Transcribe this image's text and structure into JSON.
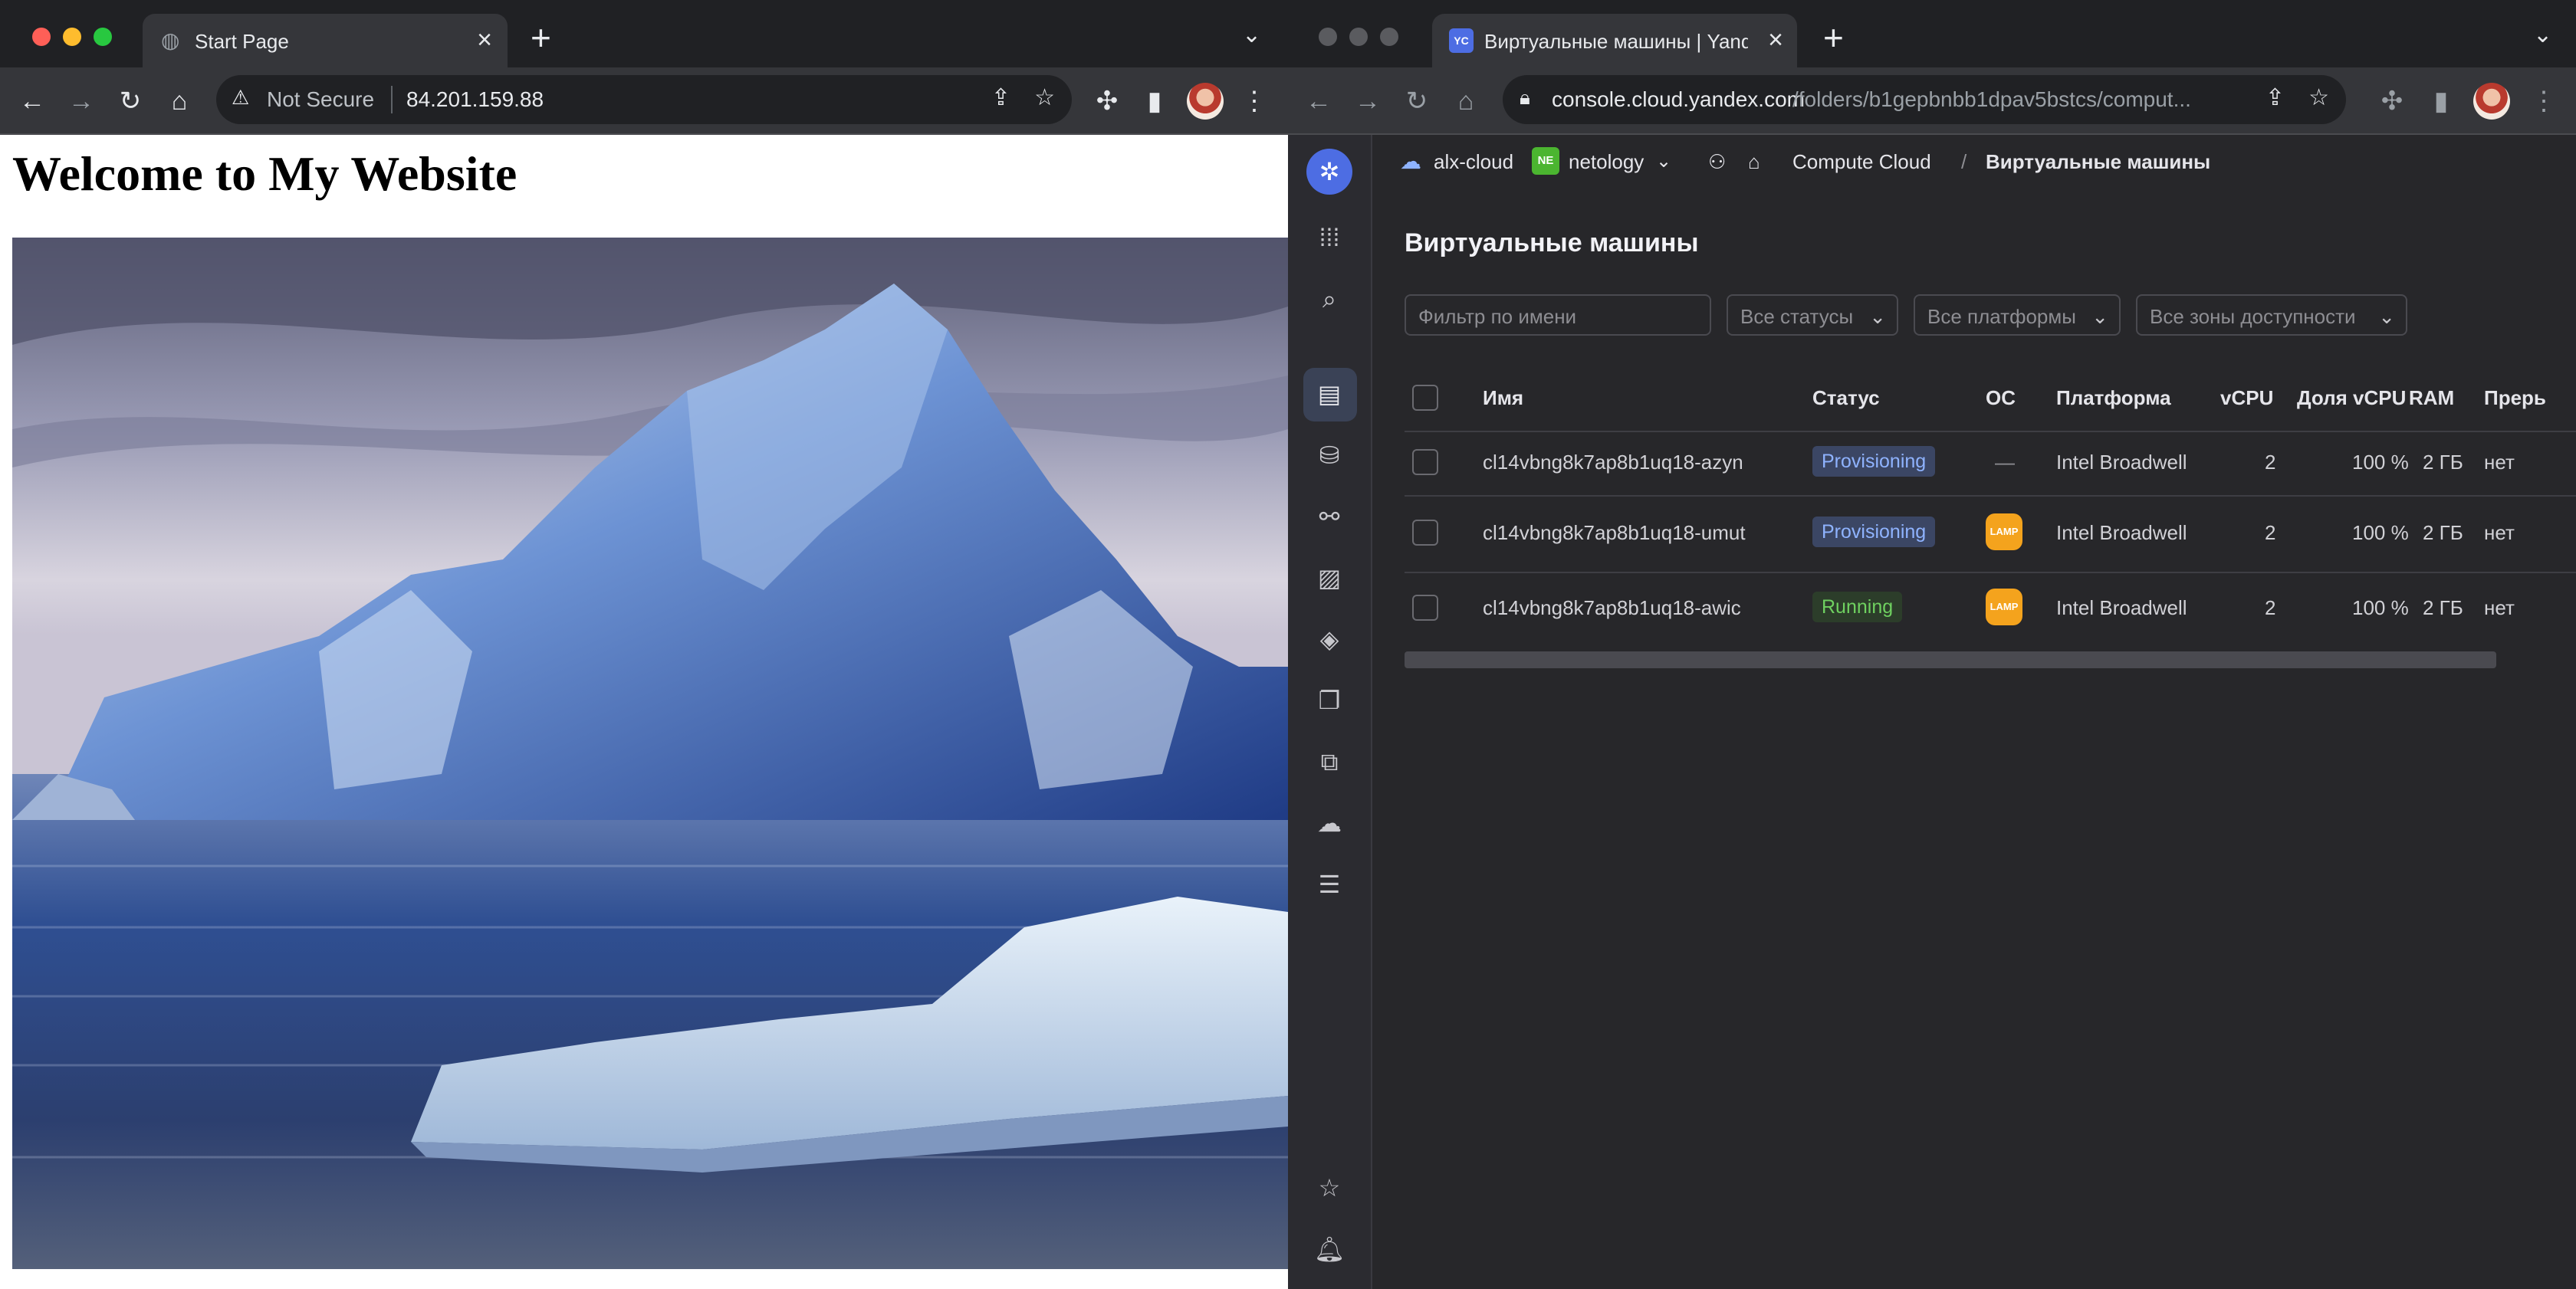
{
  "left_window": {
    "tab_title": "Start Page",
    "security_label": "Not Secure",
    "url": "84.201.159.88",
    "page_heading": "Welcome to My Website"
  },
  "right_window": {
    "tab_title": "Виртуальные машины | Yandex",
    "url_host": "console.cloud.yandex.com",
    "url_path": "/folders/b1gepbnbb1dpav5bstcs/comput...",
    "breadcrumb": {
      "cloud": "alx-cloud",
      "folder_badge": "NE",
      "folder": "netology",
      "service": "Compute Cloud",
      "separator": "/",
      "current": "Виртуальные машины"
    },
    "page_title": "Виртуальные машины",
    "filters": {
      "name_placeholder": "Фильтр по имени",
      "status": "Все статусы",
      "platform": "Все платформы",
      "zone": "Все зоны доступности"
    },
    "columns": [
      "Имя",
      "Статус",
      "ОС",
      "Платформа",
      "vCPU",
      "Доля vCPU",
      "RAM",
      "Прерь"
    ],
    "rows": [
      {
        "name": "cl14vbng8k7ap8b1uq18-azyn",
        "status": "Provisioning",
        "os": "—",
        "platform": "Intel Broadwell",
        "vcpu": "2",
        "share": "100 %",
        "ram": "2 ГБ",
        "preempt": "нет"
      },
      {
        "name": "cl14vbng8k7ap8b1uq18-umut",
        "status": "Provisioning",
        "os": "LAMP",
        "platform": "Intel Broadwell",
        "vcpu": "2",
        "share": "100 %",
        "ram": "2 ГБ",
        "preempt": "нет"
      },
      {
        "name": "cl14vbng8k7ap8b1uq18-awic",
        "status": "Running",
        "os": "LAMP",
        "platform": "Intel Broadwell",
        "vcpu": "2",
        "share": "100 %",
        "ram": "2 ГБ",
        "preempt": "нет"
      }
    ],
    "favicon_text": "YC"
  },
  "colors": {
    "provisioning_bg": "#3b4664",
    "provisioning_fg": "#8fb3ff",
    "running_bg": "#2c3d2a",
    "running_fg": "#6fd160",
    "lamp": "#f4a31d",
    "accent": "#4d6de3"
  }
}
